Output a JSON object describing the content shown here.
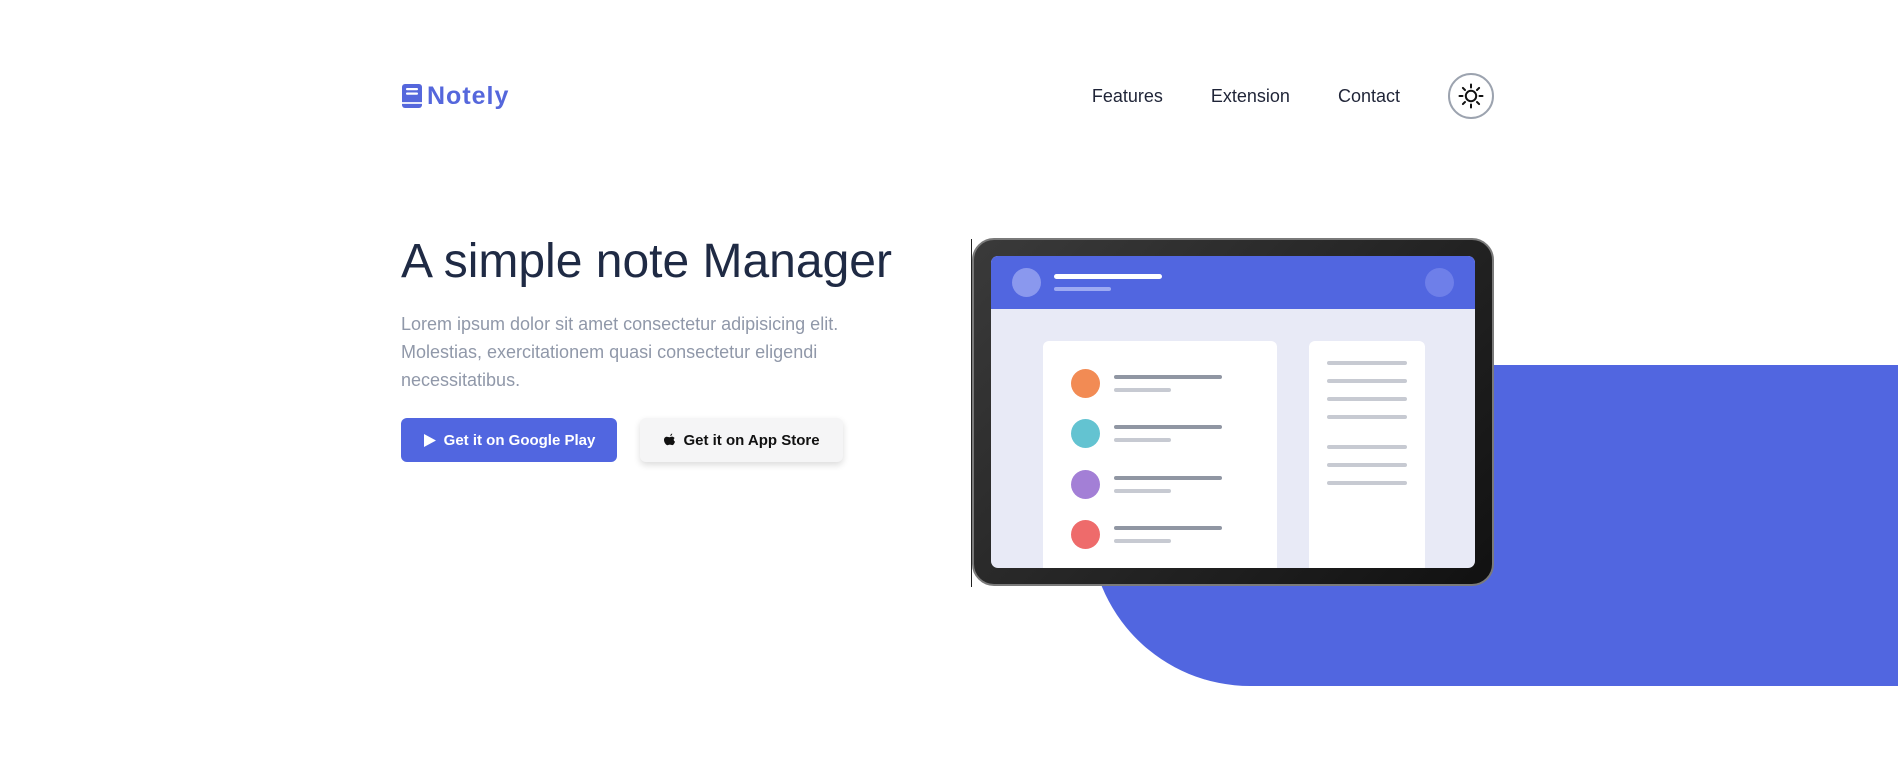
{
  "brand": {
    "name": "Notely",
    "color": "#5567dc",
    "icon": "book-icon"
  },
  "nav": {
    "links": [
      "Features",
      "Extension",
      "Contact"
    ],
    "theme_toggle_icon": "sun-icon"
  },
  "hero": {
    "title": "A simple note Manager",
    "description": "Lorem ipsum dolor sit amet consectetur adipisicing elit. Molestias, exercitationem quasi consectetur eligendi necessitatibus.",
    "buttons": {
      "google_play": {
        "label": "Get it on Google Play",
        "icon": "play-icon"
      },
      "app_store": {
        "label": "Get it on App Store",
        "icon": "apple-icon"
      }
    }
  },
  "illustration": {
    "accent_color": "#5166e0",
    "note_dot_colors": [
      "#f28b54",
      "#63c3d1",
      "#a37fd6",
      "#ee6b6b"
    ]
  }
}
